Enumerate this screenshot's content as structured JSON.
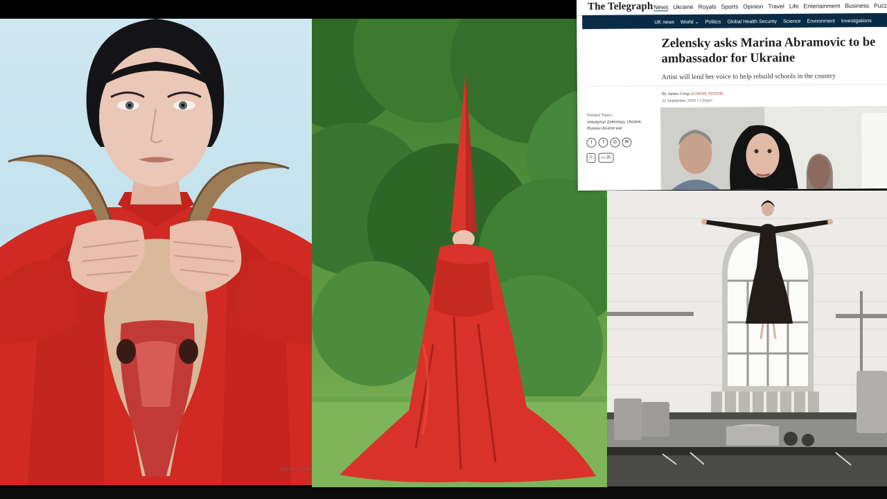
{
  "newspaper": {
    "masthead": "The Telegraph",
    "nav": [
      "News",
      "Ukraine",
      "Royals",
      "Sports",
      "Opinion",
      "Travel",
      "Life",
      "Entertainment",
      "Business",
      "Puzzles"
    ],
    "subnav": [
      "UK news",
      "World ⌄",
      "Politics",
      "Global Health Security",
      "Science",
      "Environment",
      "Investigations"
    ],
    "headline": "Zelensky asks Marina Abramovic to be ambassador for Ukraine",
    "standfirst": "Artist will lend her voice to help rebuild schools in the country",
    "byline_prefix": "By",
    "author": "James Crisp,",
    "author_role": "EUROPE EDITOR",
    "date": "22 September 2023 • 1:53pm",
    "related_label": "Related Topics",
    "related_topics": "Volodymyr Zelenskyy, Ukraine, Russia-Ukraine war",
    "comment_count": "35"
  },
  "portrait_caption": "Оригинал... Givench"
}
